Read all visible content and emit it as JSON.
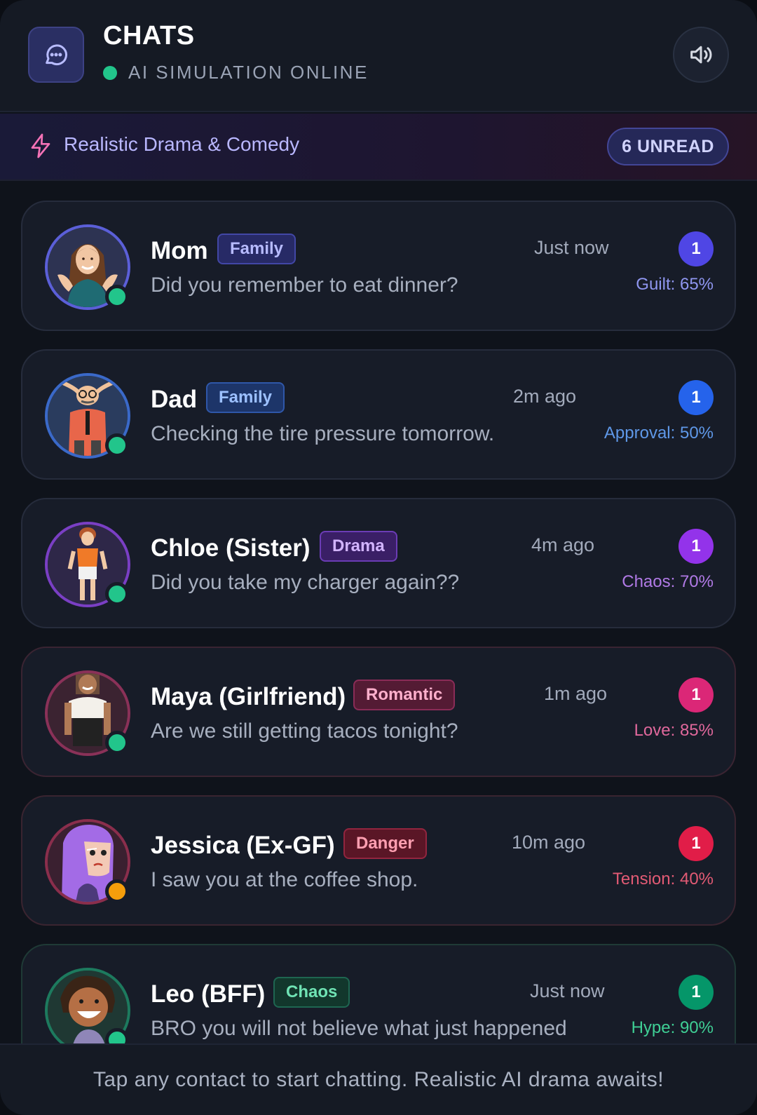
{
  "header": {
    "title": "CHATS",
    "status": "AI SIMULATION ONLINE",
    "icons": {
      "chat": "chat-bubble-icon",
      "sound": "speaker-icon"
    }
  },
  "banner": {
    "text": "Realistic Drama & Comedy",
    "unread_label": "6 UNREAD",
    "icon": "lightning-icon"
  },
  "contacts": [
    {
      "name": "Mom",
      "tag": "Family",
      "time": "Just now",
      "unread": "1",
      "message": "Did you remember to eat dinner?",
      "meter": "Guilt: 65%",
      "presence": "online",
      "accent": "#4f46e5"
    },
    {
      "name": "Dad",
      "tag": "Family",
      "time": "2m ago",
      "unread": "1",
      "message": "Checking the tire pressure tomorrow.",
      "meter": "Approval: 50%",
      "presence": "online",
      "accent": "#2563eb"
    },
    {
      "name": "Chloe (Sister)",
      "tag": "Drama",
      "time": "4m ago",
      "unread": "1",
      "message": "Did you take my charger again??",
      "meter": "Chaos: 70%",
      "presence": "online",
      "accent": "#9333ea"
    },
    {
      "name": "Maya (Girlfriend)",
      "tag": "Romantic",
      "time": "1m ago",
      "unread": "1",
      "message": "Are we still getting tacos tonight?",
      "meter": "Love: 85%",
      "presence": "online",
      "accent": "#db2777"
    },
    {
      "name": "Jessica (Ex-GF)",
      "tag": "Danger",
      "time": "10m ago",
      "unread": "1",
      "message": "I saw you at the coffee shop.",
      "meter": "Tension: 40%",
      "presence": "away",
      "accent": "#e11d48"
    },
    {
      "name": "Leo (BFF)",
      "tag": "Chaos",
      "time": "Just now",
      "unread": "1",
      "message": "BRO you will not believe what just happened",
      "meter": "Hype: 90%",
      "presence": "online",
      "accent": "#059669"
    }
  ],
  "footer": {
    "text": "Tap any contact to start chatting. Realistic AI drama awaits!"
  }
}
